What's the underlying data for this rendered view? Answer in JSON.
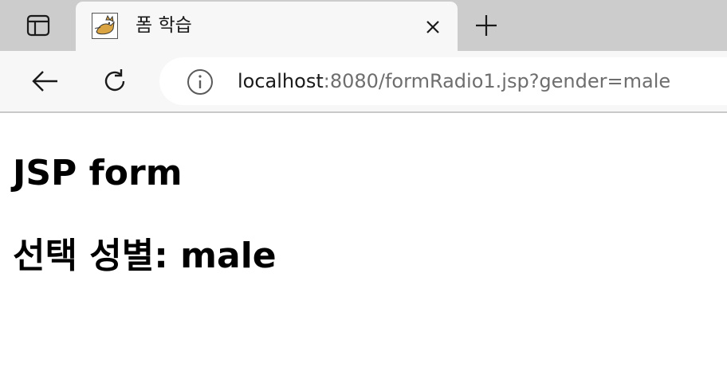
{
  "browser": {
    "tab": {
      "title": "폼 학습",
      "favicon": "tomcat-icon"
    },
    "address_bar": {
      "url_host": "localhost",
      "url_rest": ":8080/formRadio1.jsp?gender=male"
    },
    "icons": {
      "sidebar": "tab-sidebar-icon",
      "close": "close-icon",
      "new_tab": "plus-icon",
      "back": "back-arrow-icon",
      "reload": "reload-icon",
      "info": "info-icon"
    }
  },
  "page": {
    "heading": "JSP form",
    "selection_label": "선택 성별: ",
    "selection_value": "male"
  },
  "colors": {
    "tab_strip": "#cccccc",
    "toolbar": "#f7f7f7",
    "omnibox": "#ffffff",
    "url_muted": "#6e6e6e"
  }
}
